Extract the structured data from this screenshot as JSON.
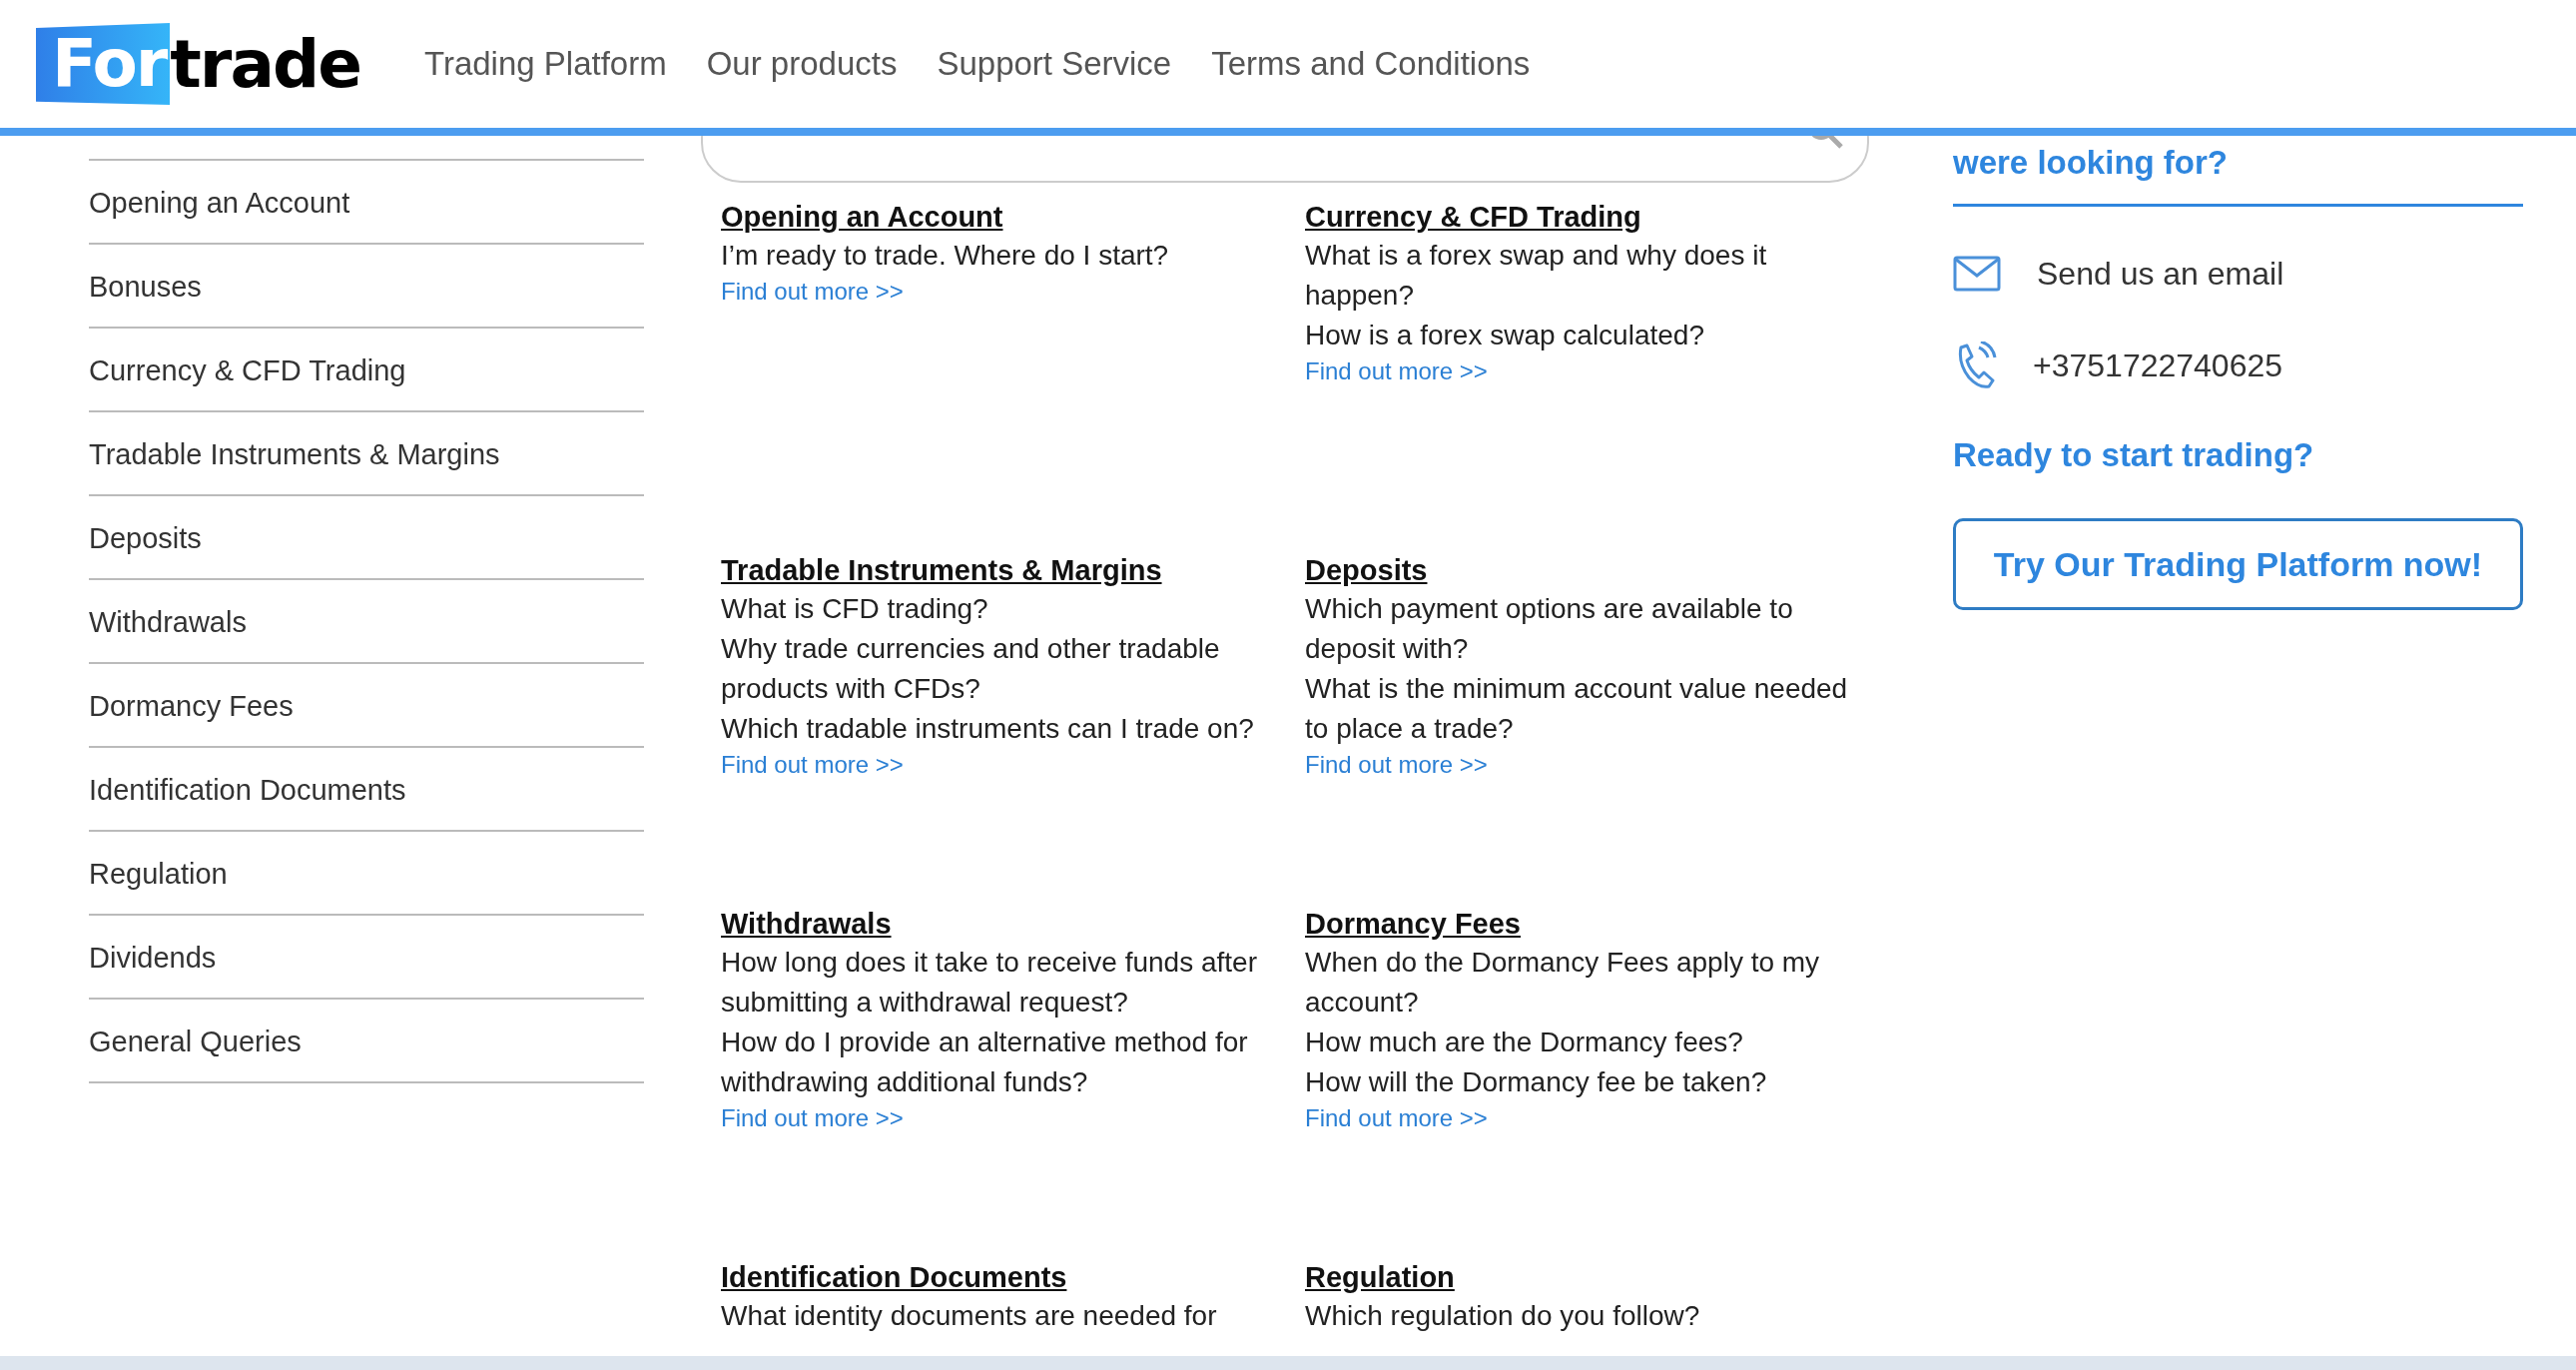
{
  "header": {
    "logo": {
      "part_1": "For",
      "part_2": "trade"
    },
    "nav": [
      {
        "label": "Trading Platform"
      },
      {
        "label": "Our products"
      },
      {
        "label": "Support Service"
      },
      {
        "label": "Terms and Conditions"
      }
    ]
  },
  "sidebar": {
    "items": [
      {
        "label": "Opening an Account"
      },
      {
        "label": "Bonuses"
      },
      {
        "label": "Currency & CFD Trading"
      },
      {
        "label": "Tradable Instruments & Margins"
      },
      {
        "label": "Deposits"
      },
      {
        "label": "Withdrawals"
      },
      {
        "label": "Dormancy Fees"
      },
      {
        "label": "Identification Documents"
      },
      {
        "label": "Regulation"
      },
      {
        "label": "Dividends"
      },
      {
        "label": "General Queries"
      }
    ]
  },
  "faq_sections": [
    {
      "title": "Opening an Account",
      "questions": [
        "I’m ready to trade. Where do I start?"
      ],
      "link": "Find out more >>"
    },
    {
      "title": "Currency & CFD Trading",
      "questions": [
        "What is a forex swap and why does it happen?",
        "How is a forex swap calculated?"
      ],
      "link": "Find out more >>"
    },
    {
      "title": "Tradable Instruments & Margins",
      "questions": [
        "What is CFD trading?",
        "Why trade currencies and other tradable products with CFDs?",
        "Which tradable instruments can I trade on?"
      ],
      "link": "Find out more >>"
    },
    {
      "title": "Deposits",
      "questions": [
        "Which payment options are available to deposit with?",
        "What is the minimum account value needed to place a trade?"
      ],
      "link": "Find out more >>"
    },
    {
      "title": "Withdrawals",
      "questions": [
        "How long does it take to receive funds after submitting a withdrawal request?",
        "How do I provide an alternative method for withdrawing additional funds?"
      ],
      "link": "Find out more >>"
    },
    {
      "title": "Dormancy Fees",
      "questions": [
        "When do the Dormancy Fees apply to my account?",
        "How much are the Dormancy fees?",
        "How will the Dormancy fee be taken?"
      ],
      "link": "Find out more >>"
    },
    {
      "title": "Identification Documents",
      "questions": [
        "What identity documents are needed for"
      ]
    },
    {
      "title": "Regulation",
      "questions": [
        "Which regulation do you follow?"
      ]
    }
  ],
  "contact": {
    "heading": "were looking for?",
    "email": "Send us an email",
    "phone": "+3751722740625",
    "cta_heading": "Ready to start trading?",
    "cta_button": "Try Our Trading Platform now!"
  }
}
